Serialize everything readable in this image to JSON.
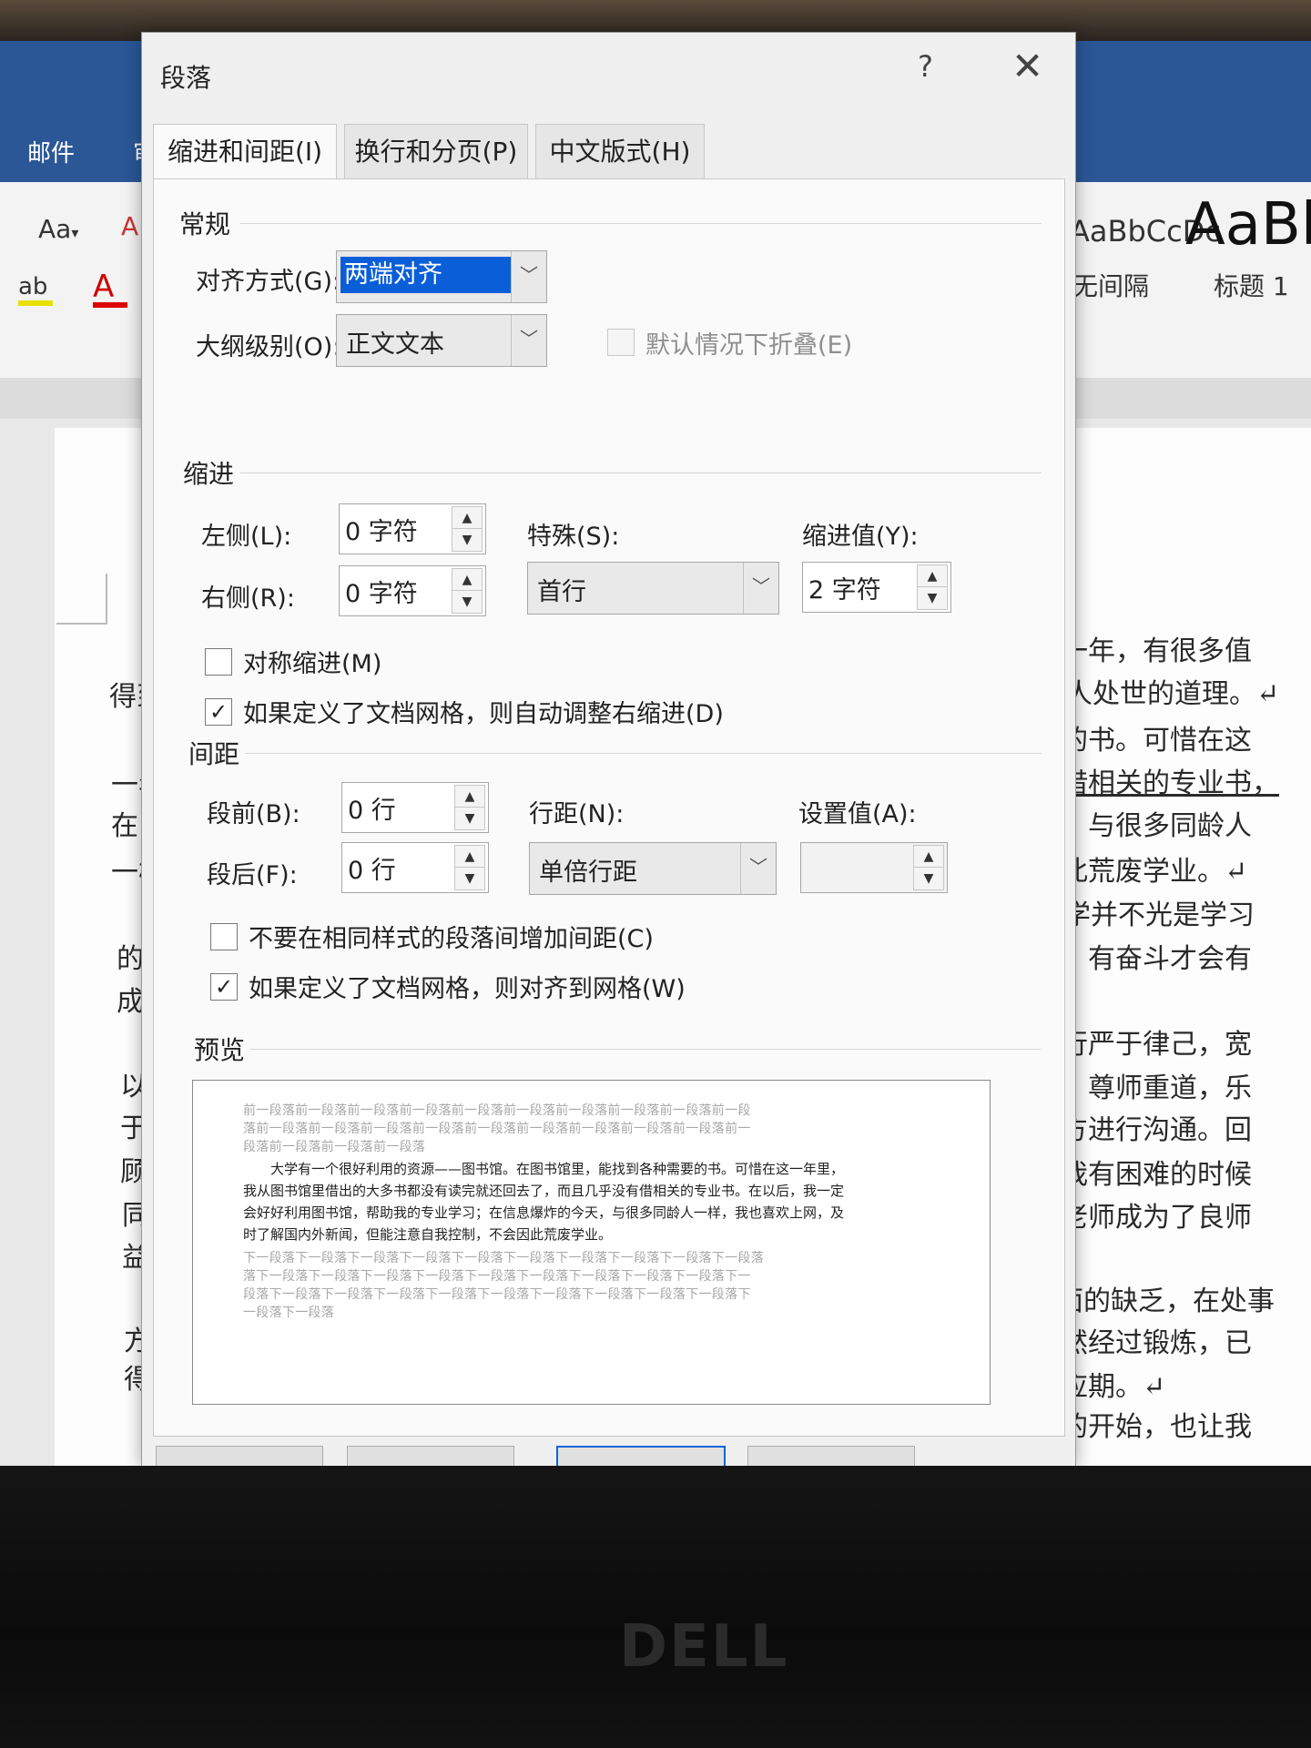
{
  "word": {
    "tabs": {
      "mail": "邮件",
      "review": "审"
    },
    "ribbon": {
      "font_size_btn": "Aa",
      "style_preview_1": "AaBbCcDc",
      "style_preview_2": "AaBl",
      "style_name_1": "无间隔",
      "style_name_2": "标题 1"
    },
    "document_lines_left": [
      "得到",
      "一年",
      "在以",
      "一样",
      "的地",
      "成果",
      "以行",
      "于助",
      "顾这",
      "同学",
      "益友",
      "方面",
      "得到"
    ],
    "document_lines_right": [
      "一年，有很多值",
      "人处世的道理。↵",
      "的书。可惜在这",
      "借相关的专业书，",
      "，与很多同龄人",
      "此荒废学业。↵",
      "学并不光是学习",
      "，有奋斗才会有",
      "行严于律己，宽",
      "，尊师重道，乐",
      "方进行沟通。回",
      "我有困难的时候",
      "老师成为了良师",
      "面的缺乏，在处事",
      "然经过锻炼，已",
      "应期。↵",
      "的开始，也让我"
    ]
  },
  "dialog": {
    "title": "段落",
    "help": "?",
    "close": "✕",
    "tabs": [
      "缩进和间距(I)",
      "换行和分页(P)",
      "中文版式(H)"
    ],
    "general": {
      "title": "常规",
      "alignment_label": "对齐方式(G):",
      "alignment_value": "两端对齐",
      "outline_label": "大纲级别(O):",
      "outline_value": "正文文本",
      "collapse_label": "默认情况下折叠(E)"
    },
    "indent": {
      "title": "缩进",
      "left_label": "左侧(L):",
      "left_value": "0 字符",
      "right_label": "右侧(R):",
      "right_value": "0 字符",
      "special_label": "特殊(S):",
      "special_value": "首行",
      "by_label": "缩进值(Y):",
      "by_value": "2 字符",
      "mirror_label": "对称缩进(M)",
      "auto_adjust_label": "如果定义了文档网格，则自动调整右缩进(D)"
    },
    "spacing": {
      "title": "间距",
      "before_label": "段前(B):",
      "before_value": "0 行",
      "after_label": "段后(F):",
      "after_value": "0 行",
      "line_label": "行距(N):",
      "line_value": "单倍行距",
      "at_label": "设置值(A):",
      "at_value": "",
      "no_space_label": "不要在相同样式的段落间增加间距(C)",
      "snap_grid_label": "如果定义了文档网格，则对齐到网格(W)"
    },
    "preview": {
      "title": "预览",
      "prev_lines": [
        "前一段落前一段落前一段落前一段落前一段落前一段落前一段落前一段落前一段落前一段",
        "落前一段落前一段落前一段落前一段落前一段落前一段落前一段落前一段落前一段落前一",
        "段落前一段落前一段落前一段落"
      ],
      "main_lines": [
        "　　大学有一个很好利用的资源——图书馆。在图书馆里，能找到各种需要的书。可惜在这一年里，",
        "我从图书馆里借出的大多书都没有读完就还回去了，而且几乎没有借相关的专业书。在以后，我一定",
        "会好好利用图书馆，帮助我的专业学习；在信息爆炸的今天，与很多同龄人一样，我也喜欢上网，及",
        "时了解国内外新闻，但能注意自我控制，不会因此荒废学业。"
      ],
      "next_lines": [
        "下一段落下一段落下一段落下一段落下一段落下一段落下一段落下一段落下一段落下一段落",
        "落下一段落下一段落下一段落下一段落下一段落下一段落下一段落下一段落下一段落下一",
        "段落下一段落下一段落下一段落下一段落下一段落下一段落下一段落下一段落下一段落下",
        "一段落下一段落"
      ]
    }
  }
}
